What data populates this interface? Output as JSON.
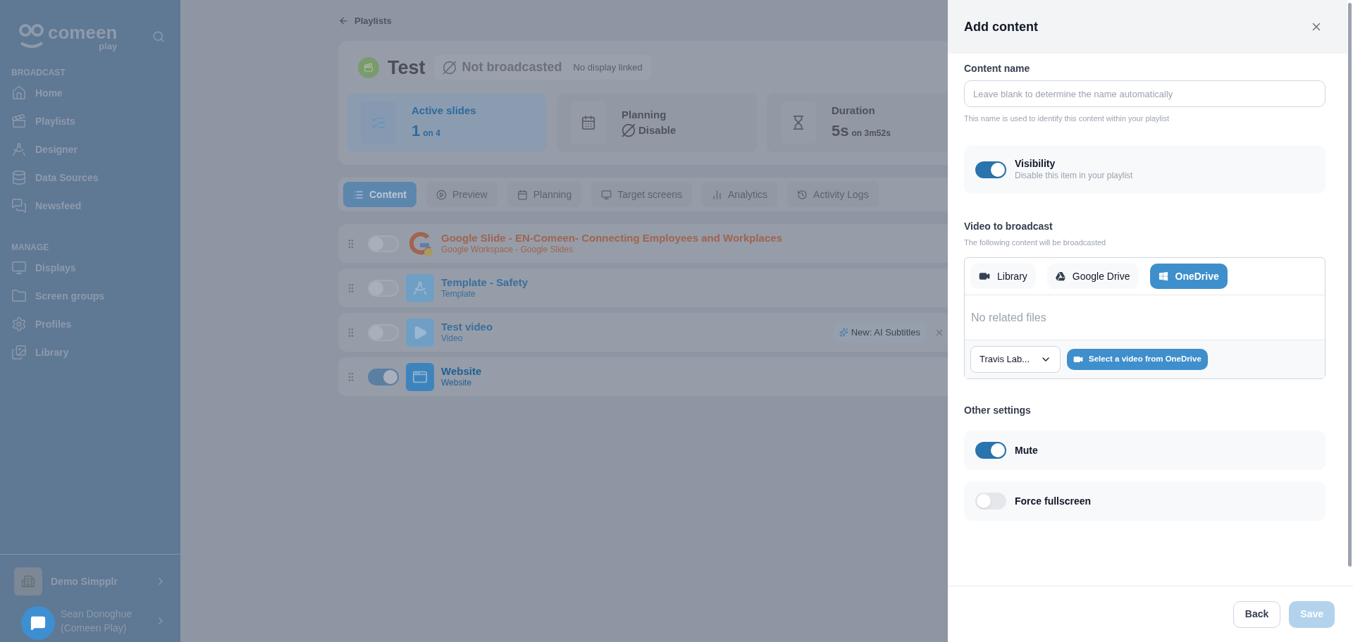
{
  "sidebar": {
    "logo": {
      "word": "comeen",
      "sub": "play"
    },
    "sections": [
      {
        "title": "BROADCAST",
        "items": [
          {
            "label": "Home",
            "kind": "home"
          },
          {
            "label": "Playlists",
            "kind": "playlists"
          },
          {
            "label": "Designer",
            "kind": "designer"
          },
          {
            "label": "Data Sources",
            "kind": "data"
          },
          {
            "label": "Newsfeed",
            "kind": "news"
          }
        ]
      },
      {
        "title": "MANAGE",
        "items": [
          {
            "label": "Displays",
            "kind": "displays"
          },
          {
            "label": "Screen groups",
            "kind": "groups"
          },
          {
            "label": "Profiles",
            "kind": "profiles"
          },
          {
            "label": "Library",
            "kind": "library"
          }
        ]
      }
    ],
    "workspace": "Demo Simpplr",
    "user": {
      "name": "Sean Donoghue",
      "org": "(Comeen Play)"
    }
  },
  "main": {
    "breadcrumb": "Playlists",
    "title": "Test",
    "status": "Not broadcasted",
    "status_note": "No display linked",
    "stats": [
      {
        "kind": "slides",
        "label": "Active slides",
        "value": "1",
        "unit": "on 4",
        "selected": true
      },
      {
        "kind": "planning",
        "label": "Planning",
        "value": "Disable",
        "selected": false
      },
      {
        "kind": "duration",
        "label": "Duration",
        "value": "5s",
        "unit": "on 3m52s",
        "selected": false
      }
    ],
    "tabs": [
      {
        "label": "Content",
        "kind": "list",
        "selected": true
      },
      {
        "label": "Preview",
        "kind": "preview",
        "selected": false
      },
      {
        "label": "Planning",
        "kind": "calendar",
        "selected": false
      },
      {
        "label": "Target screens",
        "kind": "screens",
        "selected": false
      },
      {
        "label": "Analytics",
        "kind": "analytics",
        "selected": false
      },
      {
        "label": "Activity Logs",
        "kind": "logs",
        "selected": false
      }
    ],
    "items": [
      {
        "kind": "google",
        "title": "Google Slide - EN-Comeen- Connecting Employees and Workplaces",
        "subtitle": "Google Workspace - Google Slides",
        "enabled": false,
        "color": "#a0644f"
      },
      {
        "kind": "template",
        "title": "Template - Safety",
        "subtitle": "Template",
        "enabled": false,
        "color": "#3a6f9c"
      },
      {
        "kind": "video",
        "title": "Test video",
        "subtitle": "Video",
        "enabled": false,
        "color": "#3a6f9c",
        "badge": "New: AI Subtitles"
      },
      {
        "kind": "website",
        "title": "Website",
        "subtitle": "Website",
        "enabled": true,
        "color": "#1f5f94"
      }
    ]
  },
  "drawer": {
    "title": "Add content",
    "content_name": {
      "label": "Content name",
      "placeholder": "Leave blank to determine the name automatically",
      "help": "This name is used to identify this content within your playlist"
    },
    "visibility": {
      "label": "Visibility",
      "description": "Disable this item in your playlist",
      "on": true
    },
    "video": {
      "title": "Video to broadcast",
      "subtitle": "The following content will be broadcasted",
      "sources": [
        {
          "kind": "library",
          "label": "Library",
          "selected": false
        },
        {
          "kind": "gdrive",
          "label": "Google Drive",
          "selected": false
        },
        {
          "kind": "onedrive",
          "label": "OneDrive",
          "selected": true
        }
      ],
      "empty_text": "No related files",
      "account": "Travis Lab...",
      "select_button": "Select a video from OneDrive"
    },
    "other_settings": {
      "title": "Other settings",
      "toggles": [
        {
          "label": "Mute",
          "on": true
        },
        {
          "label": "Force fullscreen",
          "on": false
        }
      ]
    },
    "back": "Back",
    "save": {
      "label": "Save",
      "disabled": true
    }
  }
}
